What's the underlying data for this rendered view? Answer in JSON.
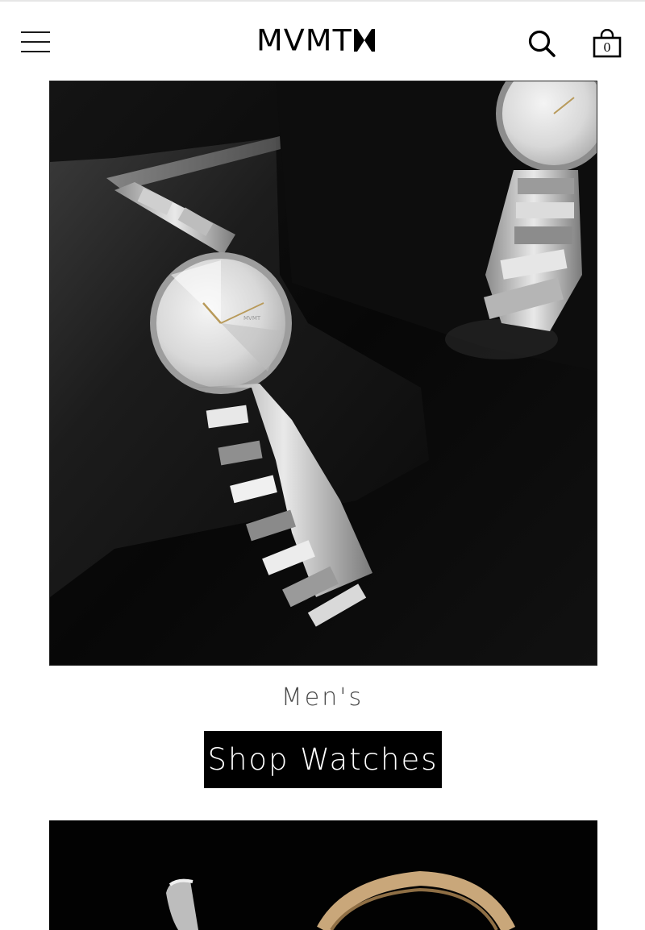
{
  "header": {
    "brand": "MVMT",
    "menu_icon": "hamburger-menu-icon",
    "search_icon": "search-icon",
    "bag_icon": "shopping-bag-icon",
    "bag_count": "0"
  },
  "featured": [
    {
      "image": "silver-watch-on-black-pedestal-photo",
      "category": "Men's",
      "cta_label": "Shop Watches"
    },
    {
      "image": "watches-on-black-background-photo"
    }
  ],
  "colors": {
    "primary": "#000000",
    "background": "#ffffff",
    "label_text": "#4a4a4a"
  }
}
